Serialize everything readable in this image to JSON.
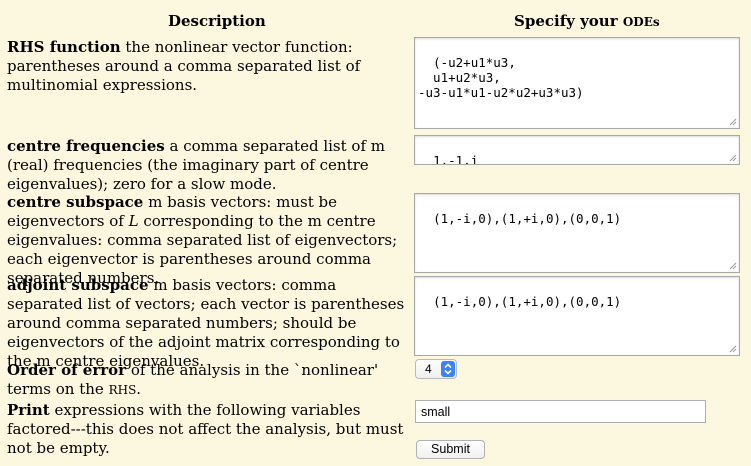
{
  "headers": {
    "description": "Description",
    "specify_prefix": "Specify your ",
    "specify_smallcaps": "ODEs"
  },
  "rhs": {
    "label": "RHS function",
    "text": " the nonlinear vector function: parentheses around a comma separated list of multinomial expressions.",
    "value": "(-u2+u1*u3,\n  u1+u2*u3,\n-u3-u1*u1-u2*u2+u3*u3)"
  },
  "centre_freq": {
    "label": "centre frequencies",
    "text": " a comma separated list of m (real) frequencies (the imaginary part of centre eigenvalues); zero for a slow mode.",
    "value": "1,-1,i"
  },
  "centre_subspace": {
    "label": "centre subspace",
    "text_before": " m basis vectors: must be eigenvectors of ",
    "matrix_symbol": "L",
    "text_after": " corresponding to the m centre eigenvalues: comma separated list of eigenvectors; each eigenvector is parentheses around comma separated numbers.",
    "value": "(1,-i,0),(1,+i,0),(0,0,1)"
  },
  "adjoint_subspace": {
    "label": "adjoint subspace",
    "text": " m basis vectors: comma separated list of vectors; each vector is parentheses around comma separated numbers; should be eigenvectors of the adjoint matrix corresponding to the m centre eigenvalues.",
    "value": "(1,-i,0),(1,+i,0),(0,0,1)"
  },
  "order_error": {
    "label": "Order of error",
    "text": " of the analysis in the `nonlinear' terms on the ",
    "rhs_smallcaps": "RHS",
    "end": ".",
    "selected": "4"
  },
  "print": {
    "label": "Print",
    "text": " expressions with the following variables factored---this does not affect the analysis, but must not be empty.",
    "value": "small"
  },
  "submit_label": "Submit",
  "colors": {
    "background": "#fcf8e0",
    "select_accent": "#3b82f6"
  }
}
